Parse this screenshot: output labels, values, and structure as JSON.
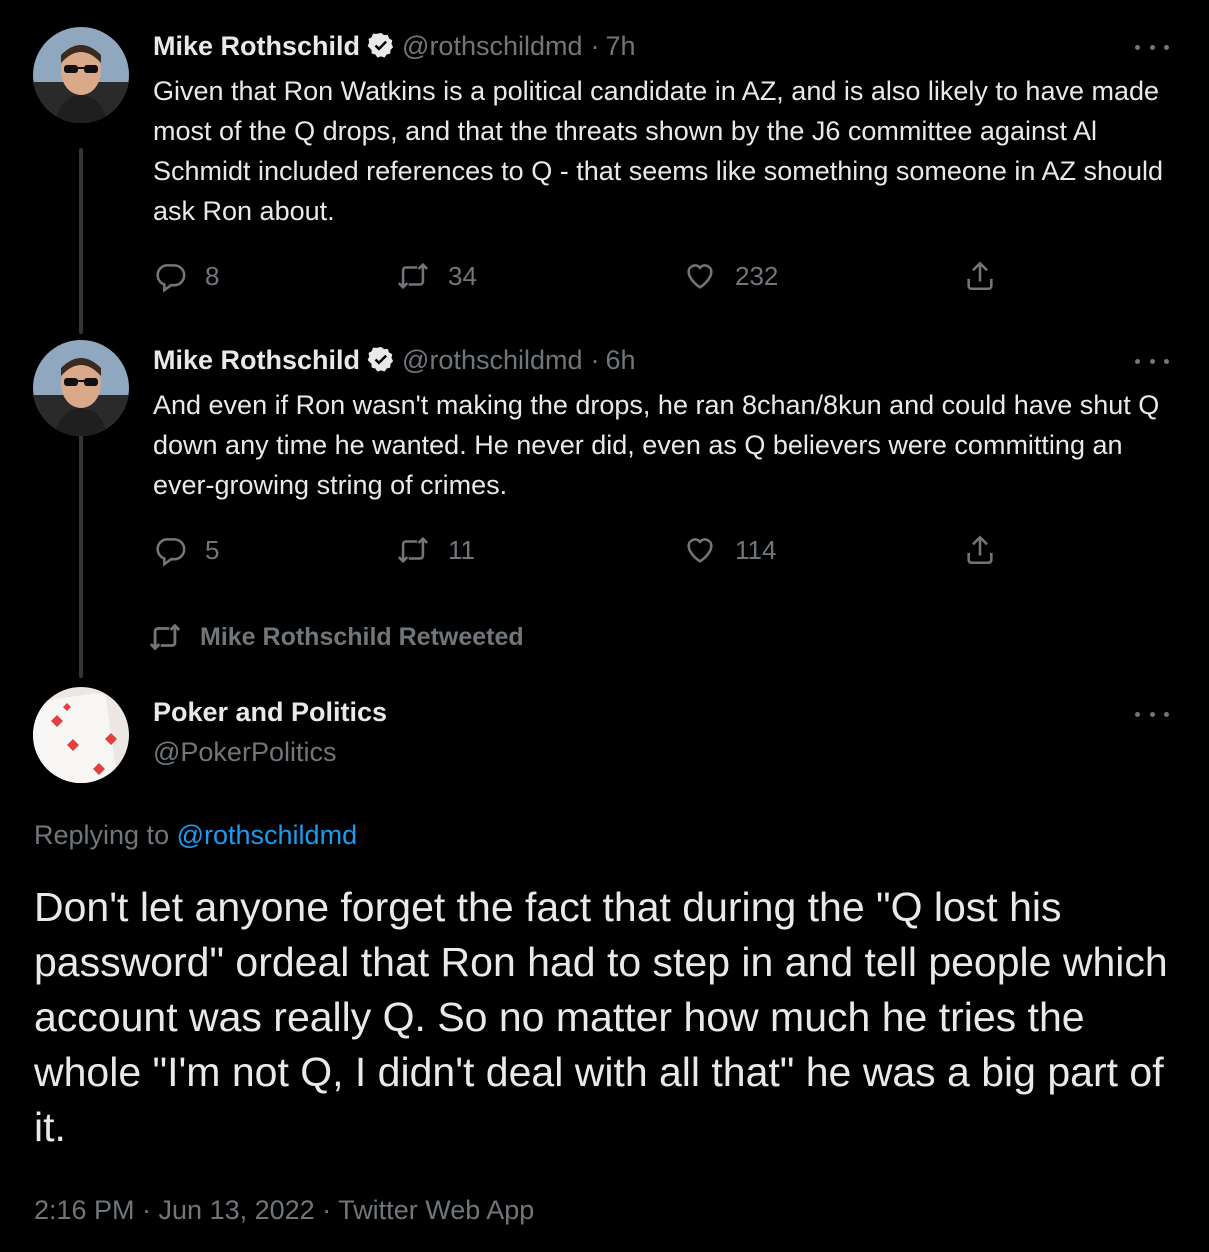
{
  "tweets": [
    {
      "display_name": "Mike Rothschild",
      "handle": "@rothschildmd",
      "separator": "·",
      "time": "7h",
      "text": "Given that Ron Watkins is a political candidate in AZ, and is also likely to have made most of the Q drops, and that the threats shown by the J6 committee against Al Schmidt included references to Q - that seems like something someone in AZ should ask Ron about.",
      "replies": "8",
      "retweets": "34",
      "likes": "232"
    },
    {
      "display_name": "Mike Rothschild",
      "handle": "@rothschildmd",
      "separator": "·",
      "time": "6h",
      "text": "And even if Ron wasn't making the drops, he ran 8chan/8kun and could have shut Q down any time he wanted. He never did, even as Q believers were committing an ever-growing string of crimes.",
      "replies": "5",
      "retweets": "11",
      "likes": "114"
    }
  ],
  "retweeted_label": "Mike Rothschild Retweeted",
  "main_tweet": {
    "display_name": "Poker and Politics",
    "handle": "@PokerPolitics",
    "replying_prefix": "Replying to",
    "replying_to": "@rothschildmd",
    "text": "Don't let anyone forget the fact that during the \"Q lost his password\" ordeal that Ron had to step in and tell people which account was really Q. So no matter how much he tries the whole \"I'm not Q, I didn't deal with all that\" he was a big part of it.",
    "meta": "2:16 PM · Jun 13, 2022 · Twitter Web App"
  },
  "colors": {
    "background": "#000000",
    "primary_text": "#e7e9ea",
    "secondary_text": "#71767b",
    "link": "#1d9bf0",
    "thread_line": "#333639"
  },
  "icons": [
    "verified-badge-icon",
    "more-icon",
    "reply-icon",
    "retweet-icon",
    "like-icon",
    "share-icon",
    "avatar-mike-rothschild",
    "avatar-poker-and-politics"
  ]
}
